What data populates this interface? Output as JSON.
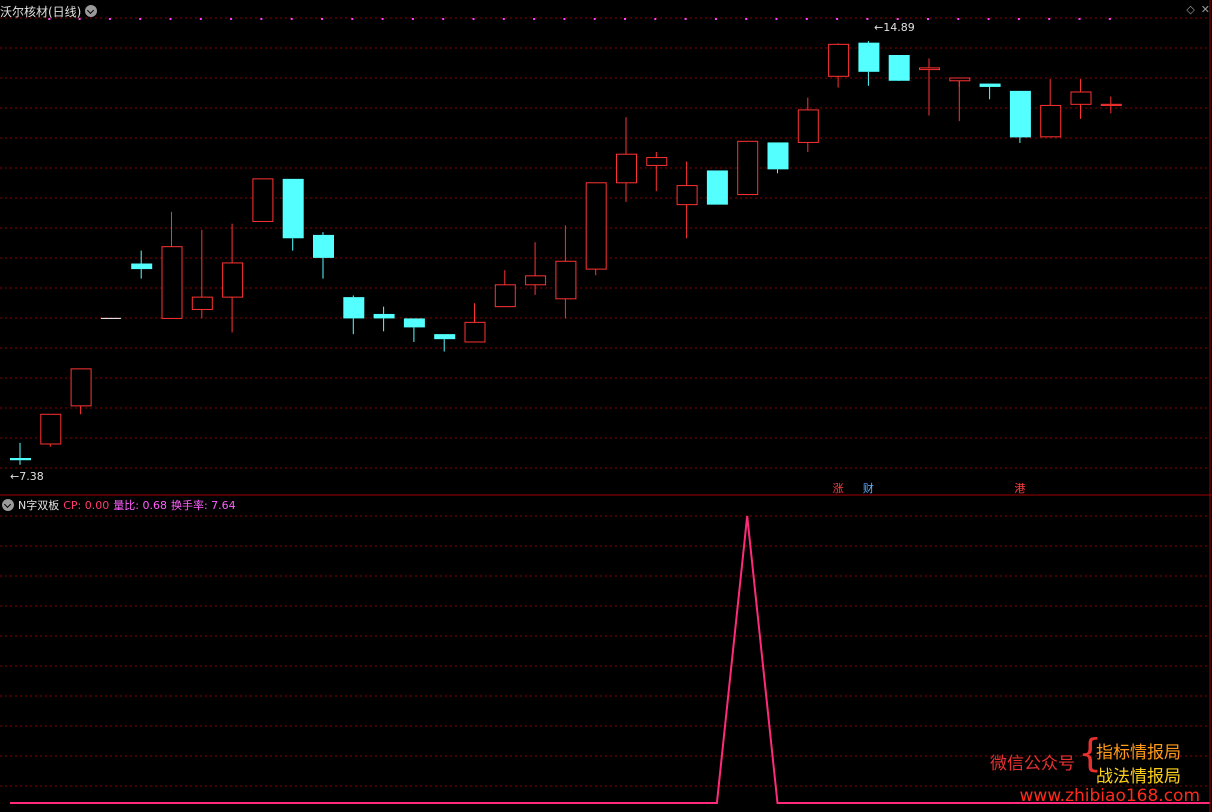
{
  "window": {
    "title": "沃尔核材(日线)",
    "corner_icons": [
      "diamond-icon",
      "close-icon"
    ]
  },
  "price_labels": {
    "high": "14.89",
    "low": "7.38"
  },
  "news_badges": [
    {
      "label": "涨",
      "color": "#ff4040",
      "bar_index": 27
    },
    {
      "label": "财",
      "color": "#60b0ff",
      "bar_index": 28
    },
    {
      "label": "港",
      "color": "#ff4040",
      "bar_index": 33
    }
  ],
  "indicator": {
    "name": "N字双板",
    "cp_text": "CP: 0.00",
    "lb_text": "量比: 0.68",
    "hs_text": "换手率: 7.64"
  },
  "watermark": {
    "left": "微信公众号",
    "line1": "指标情报局",
    "line2": "战法情报局",
    "url": "www.zhibiao168.com"
  },
  "colors": {
    "up": "#ff3232",
    "down": "#54ffff",
    "grid": "#8a0000",
    "signal": "#ff2a7a",
    "dots": "#ff40ff"
  },
  "chart_data": {
    "type": "candlestick",
    "ylim": [
      7.2,
      15.3
    ],
    "bars": [
      {
        "o": 7.45,
        "h": 7.72,
        "l": 7.33,
        "c": 7.41
      },
      {
        "o": 7.7,
        "h": 8.23,
        "l": 7.65,
        "c": 8.23
      },
      {
        "o": 8.38,
        "h": 9.04,
        "l": 8.23,
        "c": 9.04
      },
      {
        "o": 9.94,
        "h": 9.94,
        "l": 9.94,
        "c": 9.94
      },
      {
        "o": 10.92,
        "h": 11.15,
        "l": 10.65,
        "c": 10.82
      },
      {
        "o": 9.94,
        "h": 11.84,
        "l": 9.94,
        "c": 11.22
      },
      {
        "o": 10.1,
        "h": 11.52,
        "l": 9.94,
        "c": 10.32
      },
      {
        "o": 10.32,
        "h": 11.63,
        "l": 9.69,
        "c": 10.93
      },
      {
        "o": 11.67,
        "h": 12.43,
        "l": 11.67,
        "c": 12.43
      },
      {
        "o": 12.43,
        "h": 12.43,
        "l": 11.15,
        "c": 11.37
      },
      {
        "o": 11.43,
        "h": 11.48,
        "l": 10.65,
        "c": 11.02
      },
      {
        "o": 10.32,
        "h": 10.35,
        "l": 9.66,
        "c": 9.94
      },
      {
        "o": 10.02,
        "h": 10.15,
        "l": 9.71,
        "c": 9.94
      },
      {
        "o": 9.94,
        "h": 9.83,
        "l": 9.52,
        "c": 9.78
      },
      {
        "o": 9.66,
        "h": 9.66,
        "l": 9.35,
        "c": 9.57
      },
      {
        "o": 9.52,
        "h": 10.21,
        "l": 9.52,
        "c": 9.87
      },
      {
        "o": 10.15,
        "h": 10.8,
        "l": 10.15,
        "c": 10.54
      },
      {
        "o": 10.54,
        "h": 11.3,
        "l": 10.36,
        "c": 10.7
      },
      {
        "o": 10.29,
        "h": 11.6,
        "l": 9.94,
        "c": 10.96
      },
      {
        "o": 10.82,
        "h": 12.36,
        "l": 10.71,
        "c": 12.36
      },
      {
        "o": 12.36,
        "h": 13.53,
        "l": 12.02,
        "c": 12.87
      },
      {
        "o": 12.67,
        "h": 12.91,
        "l": 12.21,
        "c": 12.81
      },
      {
        "o": 11.97,
        "h": 12.74,
        "l": 11.37,
        "c": 12.31
      },
      {
        "o": 12.58,
        "h": 12.58,
        "l": 11.97,
        "c": 11.97
      },
      {
        "o": 12.15,
        "h": 13.1,
        "l": 12.15,
        "c": 13.1
      },
      {
        "o": 13.08,
        "h": 13.08,
        "l": 12.53,
        "c": 12.6
      },
      {
        "o": 13.08,
        "h": 13.88,
        "l": 12.91,
        "c": 13.66
      },
      {
        "o": 14.26,
        "h": 14.85,
        "l": 14.06,
        "c": 14.83
      },
      {
        "o": 14.86,
        "h": 14.89,
        "l": 14.09,
        "c": 14.34
      },
      {
        "o": 14.64,
        "h": 14.64,
        "l": 14.21,
        "c": 14.18
      },
      {
        "o": 14.38,
        "h": 14.58,
        "l": 13.56,
        "c": 14.41
      },
      {
        "o": 14.18,
        "h": 14.07,
        "l": 13.46,
        "c": 14.23
      },
      {
        "o": 14.13,
        "h": 14.09,
        "l": 13.85,
        "c": 14.07
      },
      {
        "o": 14.0,
        "h": 14.0,
        "l": 13.07,
        "c": 13.17
      },
      {
        "o": 13.18,
        "h": 14.21,
        "l": 13.18,
        "c": 13.74
      },
      {
        "o": 13.76,
        "h": 14.21,
        "l": 13.5,
        "c": 13.98
      },
      {
        "o": 13.74,
        "h": 13.9,
        "l": 13.6,
        "c": 13.76
      }
    ],
    "signal_line": {
      "values": [
        0,
        0,
        0,
        0,
        0,
        0,
        0,
        0,
        0,
        0,
        0,
        0,
        0,
        0,
        0,
        0,
        0,
        0,
        0,
        0,
        0,
        0,
        0,
        0,
        1,
        0,
        0,
        0,
        0,
        0,
        0,
        0,
        0,
        0,
        0,
        0,
        0,
        0,
        0,
        0
      ],
      "ylim": [
        0,
        1
      ]
    }
  }
}
